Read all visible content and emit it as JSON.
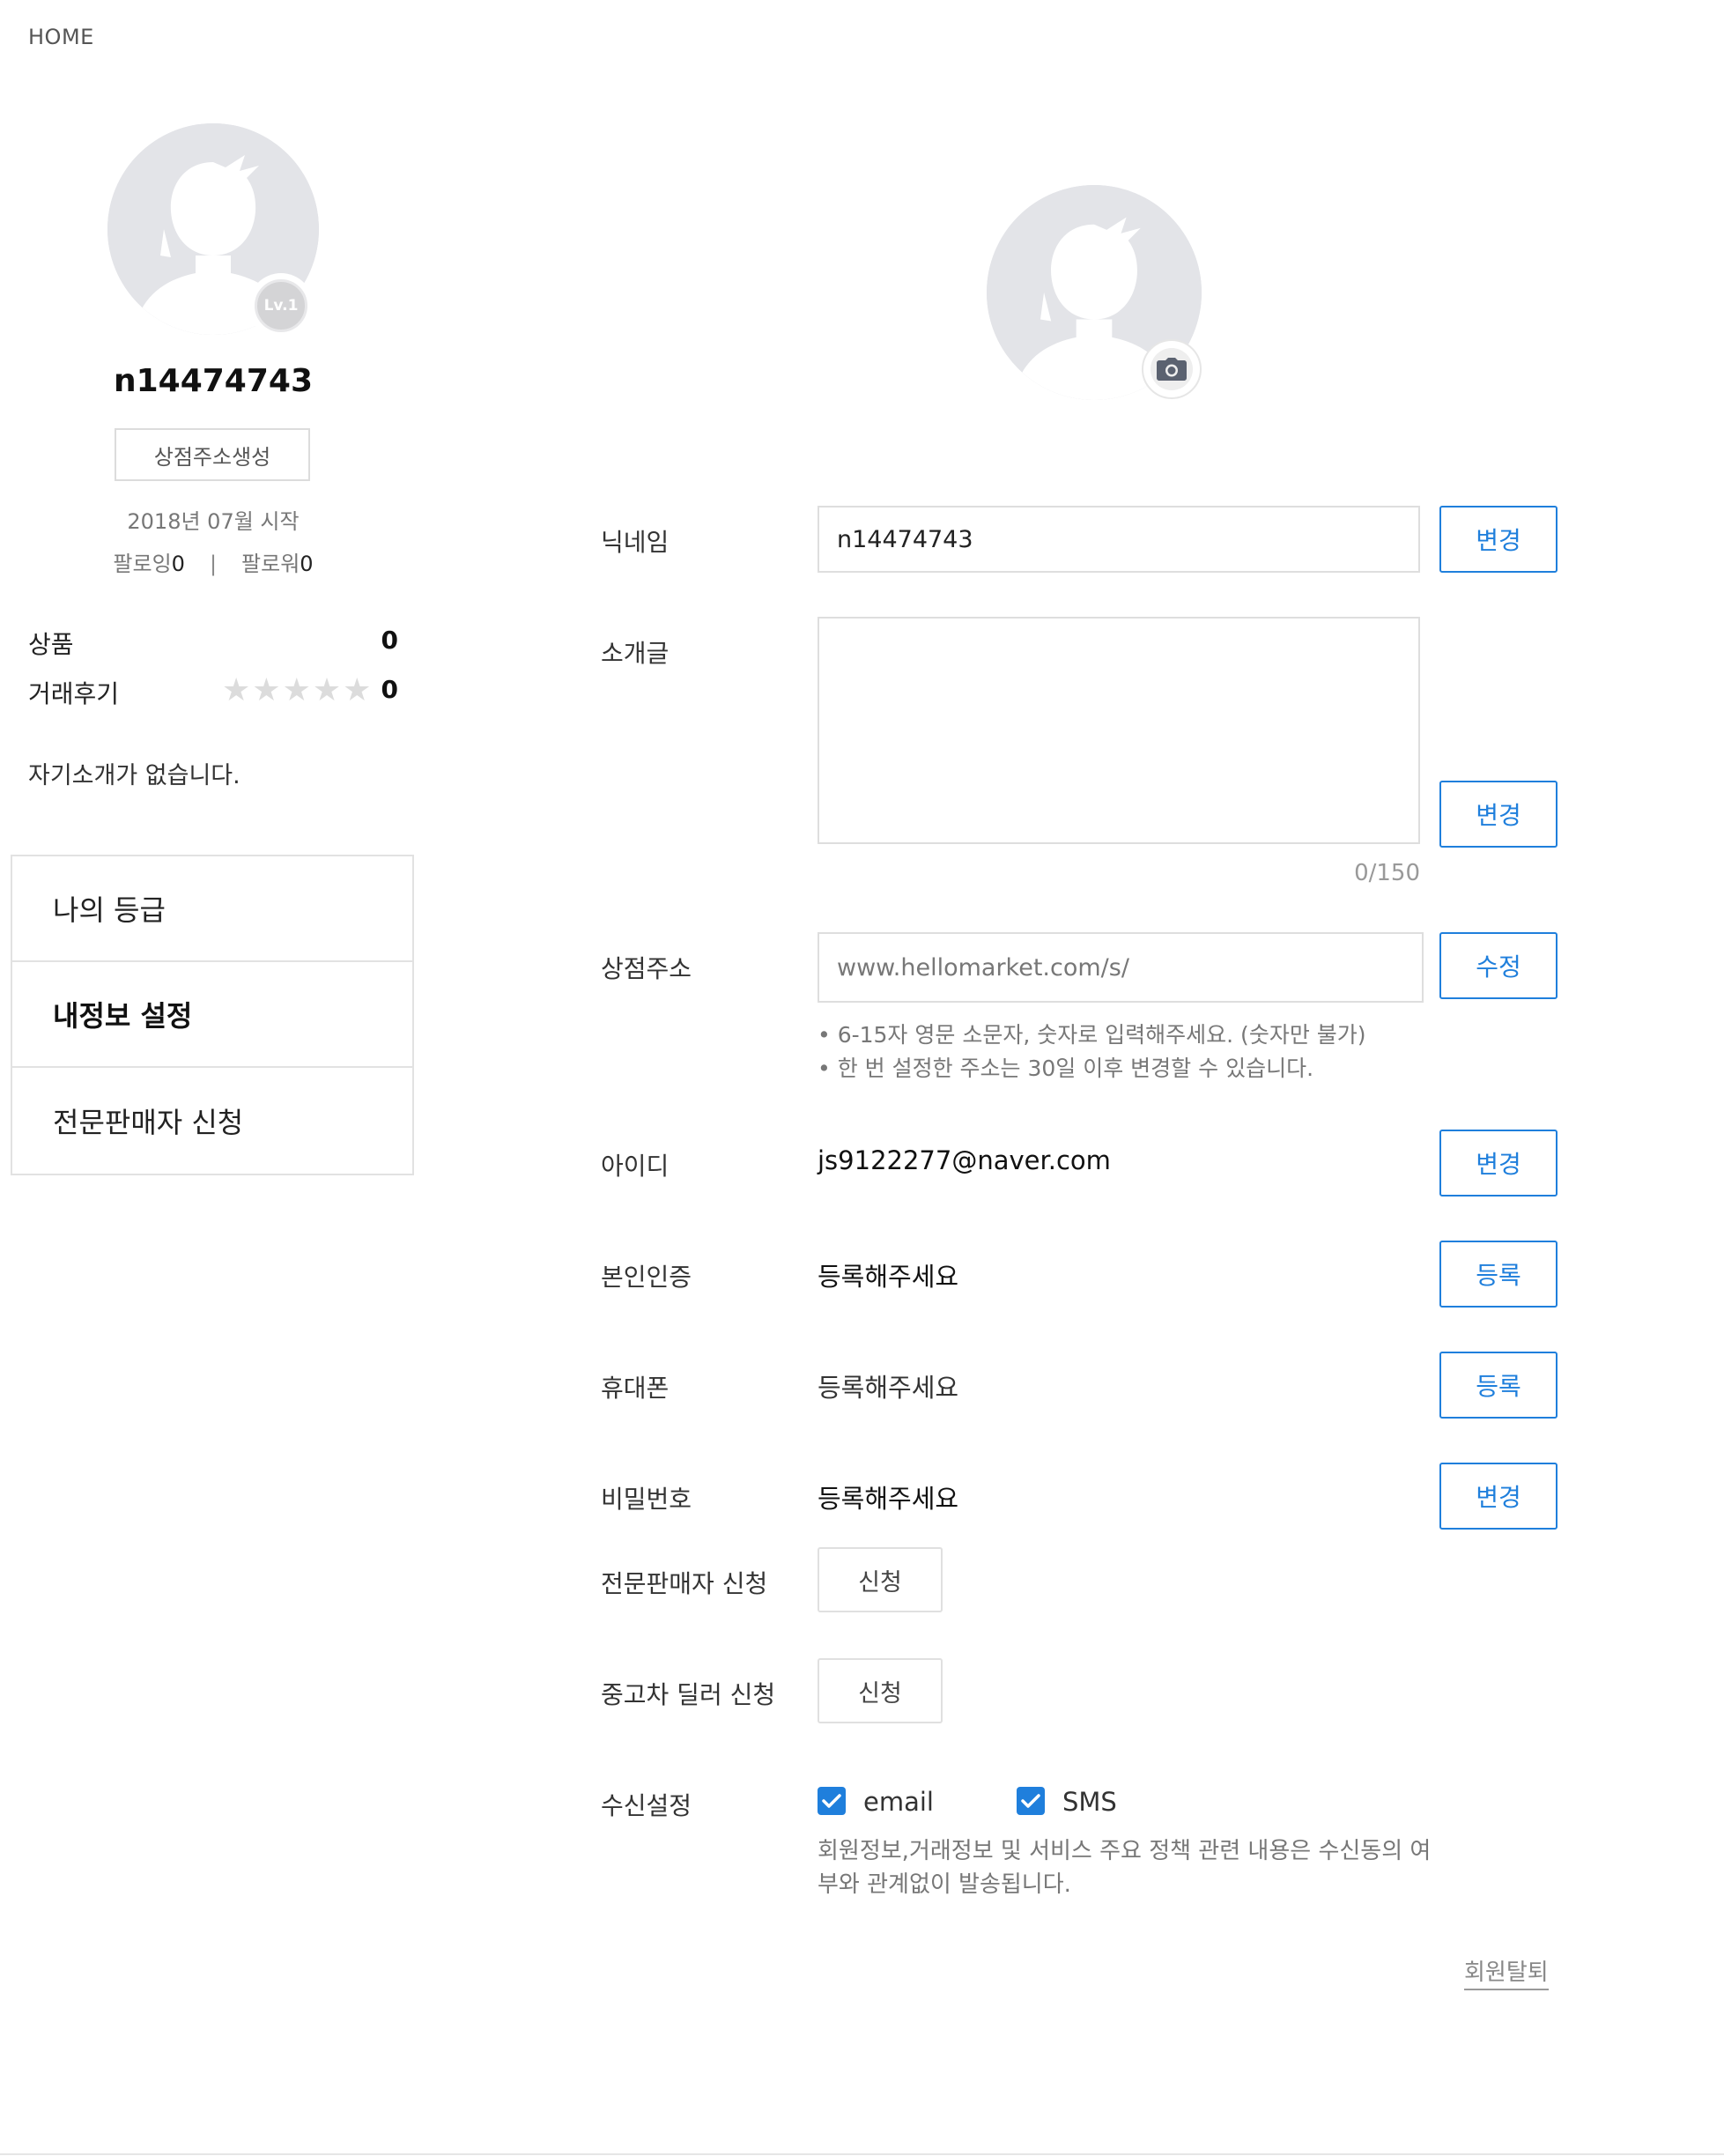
{
  "breadcrumb": "HOME",
  "profile": {
    "level_badge": "Lv.1",
    "username": "n14474743",
    "shop_create_label": "상점주소생성",
    "joined": "2018년 07월 시작",
    "following_label": "팔로잉",
    "following_count": "0",
    "follow_separator": "|",
    "followers_label": "팔로워",
    "followers_count": "0",
    "products_label": "상품",
    "products_count": "0",
    "reviews_label": "거래후기",
    "reviews_count": "0",
    "review_rating": 0,
    "intro": "자기소개가 없습니다."
  },
  "side_menu": [
    {
      "label": "나의 등급",
      "active": false
    },
    {
      "label": "내정보 설정",
      "active": true
    },
    {
      "label": "전문판매자 신청",
      "active": false
    }
  ],
  "settings": {
    "nickname": {
      "label": "닉네임",
      "value": "n14474743",
      "button": "변경"
    },
    "intro": {
      "label": "소개글",
      "value": "",
      "counter": "0/150",
      "button": "변경"
    },
    "shop_address": {
      "label": "상점주소",
      "placeholder": "www.hellomarket.com/s/",
      "button": "수정",
      "hints": [
        "• 6-15자 영문 소문자, 숫자로 입력해주세요. (숫자만 불가)",
        "• 한 번 설정한 주소는 30일 이후 변경할 수 있습니다."
      ]
    },
    "user_id": {
      "label": "아이디",
      "value": "js9122277@naver.com",
      "button": "변경"
    },
    "verification": {
      "label": "본인인증",
      "value": "등록해주세요",
      "button": "등록"
    },
    "phone": {
      "label": "휴대폰",
      "value": "등록해주세요",
      "button": "등록"
    },
    "password": {
      "label": "비밀번호",
      "value": "등록해주세요",
      "button": "변경"
    },
    "pro_seller": {
      "label": "전문판매자 신청",
      "button": "신청"
    },
    "car_dealer": {
      "label": "중고차 딜러 신청",
      "button": "신청"
    },
    "receive": {
      "label": "수신설정",
      "email_label": "email",
      "email_checked": true,
      "sms_label": "SMS",
      "sms_checked": true,
      "notice_line1": "회원정보,거래정보 및 서비스 주요 정책 관련 내용은 수신동의 여",
      "notice_line2": "부와 관계없이 발송됩니다."
    },
    "withdraw": "회원탈퇴"
  },
  "colors": {
    "accent": "#1f7fdc",
    "border": "#dedede",
    "avatar_bg": "#e3e4e8"
  },
  "icons": [
    "avatar-silhouette-icon",
    "level-badge-icon",
    "star-icon",
    "camera-icon",
    "check-icon"
  ]
}
